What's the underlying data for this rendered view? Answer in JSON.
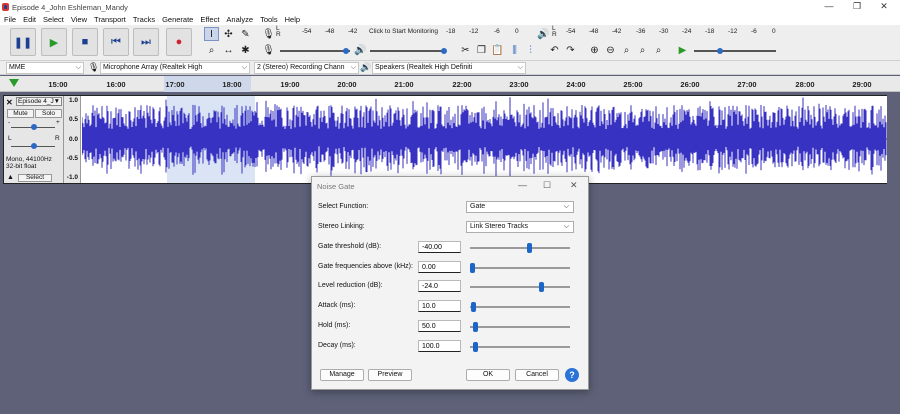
{
  "window": {
    "title": "Episode 4_John Eshleman_Mandy",
    "minimize": "—",
    "maximize": "❐",
    "close": "✕"
  },
  "menu": [
    "File",
    "Edit",
    "Select",
    "View",
    "Transport",
    "Tracks",
    "Generate",
    "Effect",
    "Analyze",
    "Tools",
    "Help"
  ],
  "transport": {
    "pause": "❚❚",
    "play": "▶",
    "stop": "■",
    "skip_start": "⏮",
    "skip_end": "⏭",
    "record": "●"
  },
  "meters": {
    "record_scale": [
      "-54",
      "-48",
      "-42"
    ],
    "monitor_label": "Click to Start Monitoring",
    "record_scale2": [
      "-18",
      "-12",
      "-6",
      "0"
    ],
    "playback_scale": [
      "-54",
      "-48",
      "-42",
      "-36",
      "-30",
      "-24",
      "-18",
      "-12",
      "-6",
      "0"
    ],
    "lr_top": "L",
    "lr_bottom": "R"
  },
  "devices": {
    "host": "MME",
    "recording_device": "Microphone Array (Realtek High",
    "channels": "2 (Stereo) Recording Chann",
    "playback_device": "Speakers (Realtek High Definiti"
  },
  "timeline": {
    "labels": [
      {
        "text": "15:00",
        "pos": 58
      },
      {
        "text": "16:00",
        "pos": 116
      },
      {
        "text": "17:00",
        "pos": 175
      },
      {
        "text": "18:00",
        "pos": 232
      },
      {
        "text": "19:00",
        "pos": 290
      },
      {
        "text": "20:00",
        "pos": 347
      },
      {
        "text": "21:00",
        "pos": 404
      },
      {
        "text": "22:00",
        "pos": 462
      },
      {
        "text": "23:00",
        "pos": 519
      },
      {
        "text": "24:00",
        "pos": 576
      },
      {
        "text": "25:00",
        "pos": 633
      },
      {
        "text": "26:00",
        "pos": 690
      },
      {
        "text": "27:00",
        "pos": 747
      },
      {
        "text": "28:00",
        "pos": 805
      },
      {
        "text": "29:00",
        "pos": 862
      }
    ]
  },
  "track": {
    "name": "Episode 4_J",
    "close": "✕",
    "dropdown": "▼",
    "mute": "Mute",
    "solo": "Solo",
    "gain_minus": "-",
    "gain_plus": "+",
    "pan_left": "L",
    "pan_right": "R",
    "info_rate": "Mono, 44100Hz",
    "info_format": "32-bit float",
    "collapse": "▲",
    "select": "Select",
    "scale": [
      "1.0",
      "0.5",
      "0.0",
      "-0.5",
      "-1.0"
    ]
  },
  "dialog": {
    "title": "Noise Gate",
    "rows": [
      {
        "label": "Select Function:",
        "type": "select",
        "value": "Gate"
      },
      {
        "label": "Stereo Linking:",
        "type": "select",
        "value": "Link Stereo Tracks"
      },
      {
        "label": "Gate threshold (dB):",
        "type": "slider",
        "value": "-40.00",
        "level": 0.6
      },
      {
        "label": "Gate frequencies above (kHz):",
        "type": "slider",
        "value": "0.00",
        "level": 0.0
      },
      {
        "label": "Level reduction (dB):",
        "type": "slider",
        "value": "-24.0",
        "level": 0.73
      },
      {
        "label": "Attack (ms):",
        "type": "slider",
        "value": "10.0",
        "level": 0.01
      },
      {
        "label": "Hold (ms):",
        "type": "slider",
        "value": "50.0",
        "level": 0.03
      },
      {
        "label": "Decay (ms):",
        "type": "slider",
        "value": "100.0",
        "level": 0.03
      }
    ],
    "buttons": {
      "manage": "Manage",
      "preview": "Preview",
      "ok": "OK",
      "cancel": "Cancel",
      "help": "?"
    }
  }
}
